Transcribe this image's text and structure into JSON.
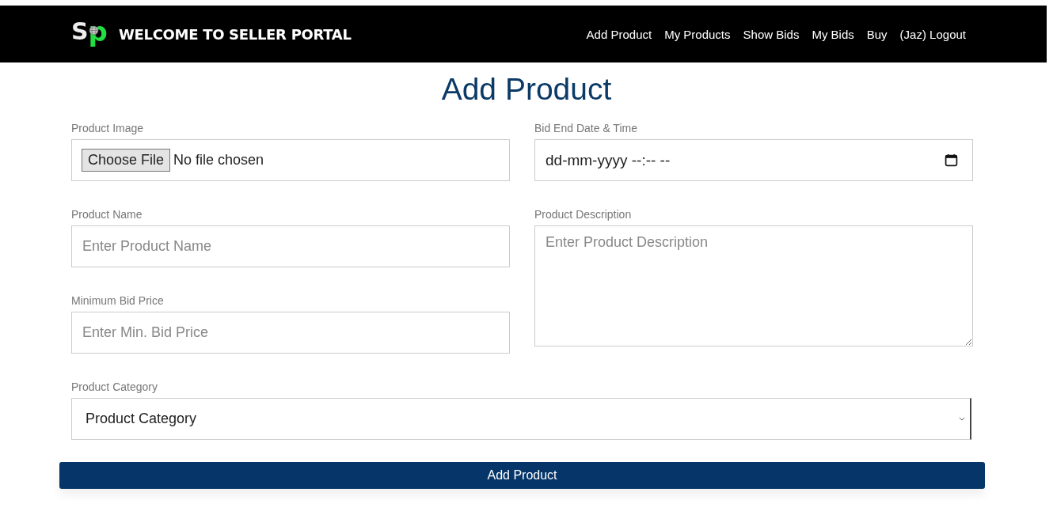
{
  "header": {
    "logo": {
      "first_letter": "S",
      "second_letter": "p"
    },
    "title": "WELCOME TO SELLER PORTAL",
    "nav": [
      {
        "label": "Add Product"
      },
      {
        "label": "My Products"
      },
      {
        "label": "Show Bids"
      },
      {
        "label": "My Bids"
      },
      {
        "label": "Buy"
      },
      {
        "label": "(Jaz) Logout"
      }
    ]
  },
  "page_title": "Add Product",
  "form": {
    "product_image": {
      "label": "Product Image",
      "button": "Choose File",
      "status": "No file chosen"
    },
    "bid_end": {
      "label": "Bid End Date & Time",
      "value": "dd-mm-yyyy --:-- --"
    },
    "product_name": {
      "label": "Product Name",
      "placeholder": "Enter Product Name"
    },
    "description": {
      "label": "Product Description",
      "placeholder": "Enter Product Description"
    },
    "min_price": {
      "label": "Minimum Bid Price",
      "placeholder": "Enter Min. Bid Price"
    },
    "category": {
      "label": "Product Category",
      "value": "Product Category"
    },
    "submit": "Add Product"
  }
}
